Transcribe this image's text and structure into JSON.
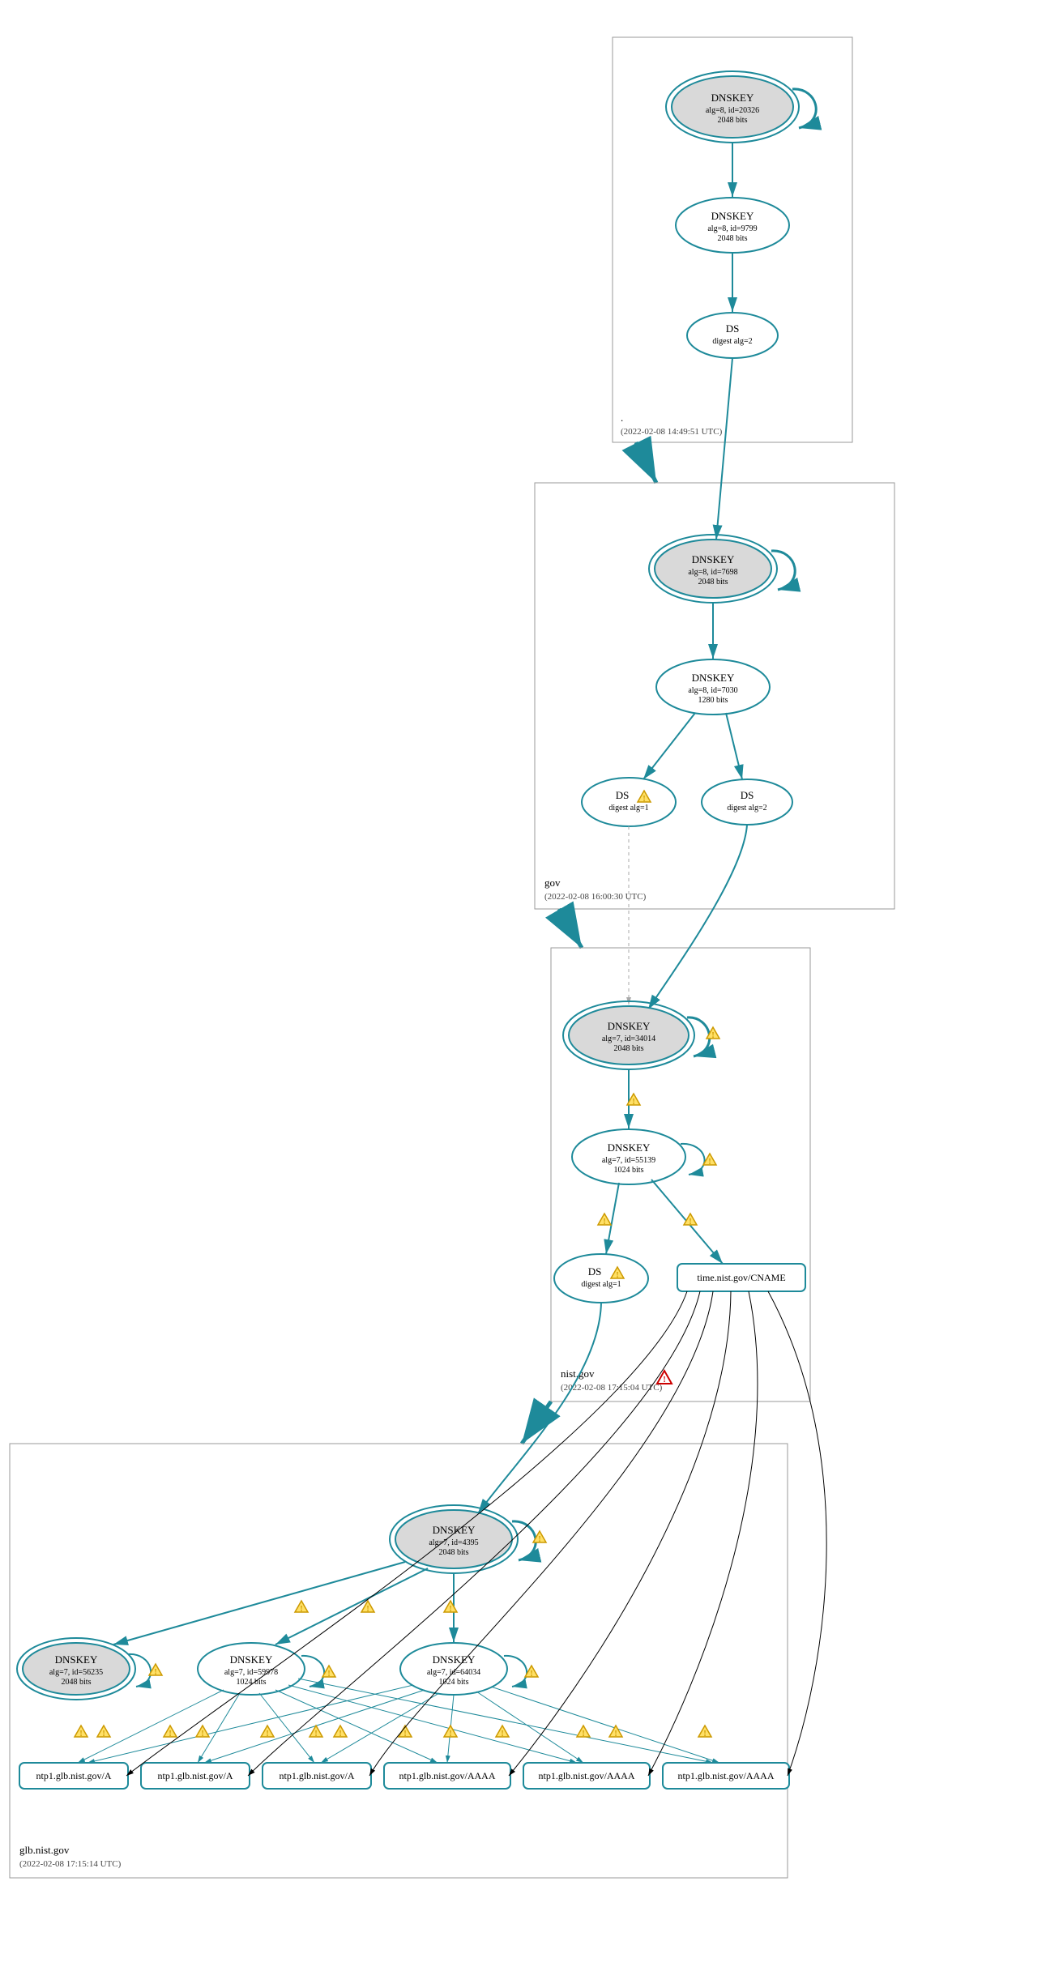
{
  "zones": {
    "root": {
      "name": ".",
      "timestamp": "(2022-02-08 14:49:51 UTC)"
    },
    "gov": {
      "name": "gov",
      "timestamp": "(2022-02-08 16:00:30 UTC)"
    },
    "nist": {
      "name": "nist.gov",
      "timestamp": "(2022-02-08 17:15:04 UTC)"
    },
    "glb": {
      "name": "glb.nist.gov",
      "timestamp": "(2022-02-08 17:15:14 UTC)"
    }
  },
  "nodes": {
    "root_ksk": {
      "title": "DNSKEY",
      "l2": "alg=8, id=20326",
      "l3": "2048 bits"
    },
    "root_zsk": {
      "title": "DNSKEY",
      "l2": "alg=8, id=9799",
      "l3": "2048 bits"
    },
    "root_ds": {
      "title": "DS",
      "l2": "digest alg=2"
    },
    "gov_ksk": {
      "title": "DNSKEY",
      "l2": "alg=8, id=7698",
      "l3": "2048 bits"
    },
    "gov_zsk": {
      "title": "DNSKEY",
      "l2": "alg=8, id=7030",
      "l3": "1280 bits"
    },
    "gov_ds1": {
      "title": "DS",
      "l2": "digest alg=1"
    },
    "gov_ds2": {
      "title": "DS",
      "l2": "digest alg=2"
    },
    "nist_ksk": {
      "title": "DNSKEY",
      "l2": "alg=7, id=34014",
      "l3": "2048 bits"
    },
    "nist_zsk": {
      "title": "DNSKEY",
      "l2": "alg=7, id=55139",
      "l3": "1024 bits"
    },
    "nist_ds": {
      "title": "DS",
      "l2": "digest alg=1"
    },
    "nist_cname": {
      "label": "time.nist.gov/CNAME"
    },
    "glb_ksk": {
      "title": "DNSKEY",
      "l2": "alg=7, id=4395",
      "l3": "2048 bits"
    },
    "glb_sep": {
      "title": "DNSKEY",
      "l2": "alg=7, id=56235",
      "l3": "2048 bits"
    },
    "glb_z1": {
      "title": "DNSKEY",
      "l2": "alg=7, id=59978",
      "l3": "1024 bits"
    },
    "glb_z2": {
      "title": "DNSKEY",
      "l2": "alg=7, id=64034",
      "l3": "1024 bits"
    },
    "rrA1": {
      "label": "ntp1.glb.nist.gov/A"
    },
    "rrA2": {
      "label": "ntp1.glb.nist.gov/A"
    },
    "rrA3": {
      "label": "ntp1.glb.nist.gov/A"
    },
    "rrAAAA1": {
      "label": "ntp1.glb.nist.gov/AAAA"
    },
    "rrAAAA2": {
      "label": "ntp1.glb.nist.gov/AAAA"
    },
    "rrAAAA3": {
      "label": "ntp1.glb.nist.gov/AAAA"
    }
  }
}
